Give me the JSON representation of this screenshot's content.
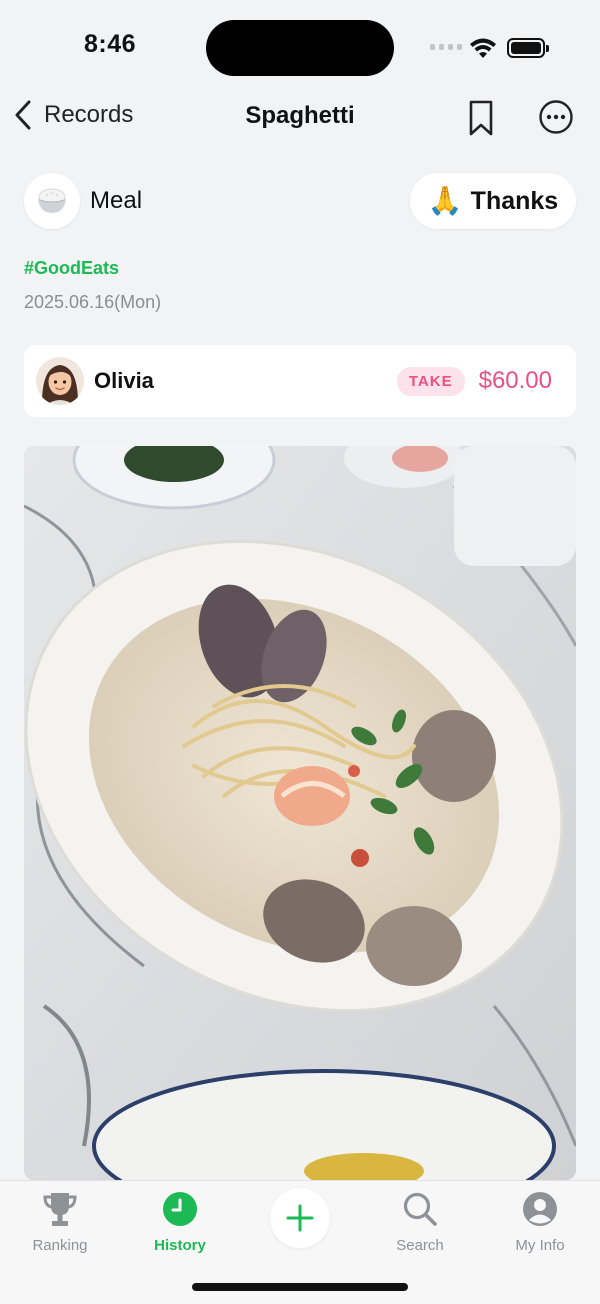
{
  "status": {
    "time": "8:46"
  },
  "nav": {
    "back_label": "Records",
    "title": "Spaghetti"
  },
  "category": {
    "icon": "rice-bowl-icon",
    "label": "Meal"
  },
  "thanks": {
    "emoji": "🙏",
    "label": "Thanks"
  },
  "hashtag": "#GoodEats",
  "date": "2025.06.16(Mon)",
  "transaction": {
    "person": "Olivia",
    "type": "TAKE",
    "amount": "$60.00"
  },
  "photo": {
    "subject": "spaghetti-with-clams-and-shrimp"
  },
  "tabs": [
    {
      "label": "Ranking",
      "icon": "trophy-icon"
    },
    {
      "label": "History",
      "icon": "clock-icon",
      "active": true
    },
    {
      "label": "",
      "icon": "plus-icon"
    },
    {
      "label": "Search",
      "icon": "search-icon"
    },
    {
      "label": "My Info",
      "icon": "profile-icon"
    }
  ],
  "colors": {
    "accent": "#1db954",
    "amount": "#ec4f82",
    "badge_bg": "#fde2ec",
    "background": "#f2f3f5"
  }
}
